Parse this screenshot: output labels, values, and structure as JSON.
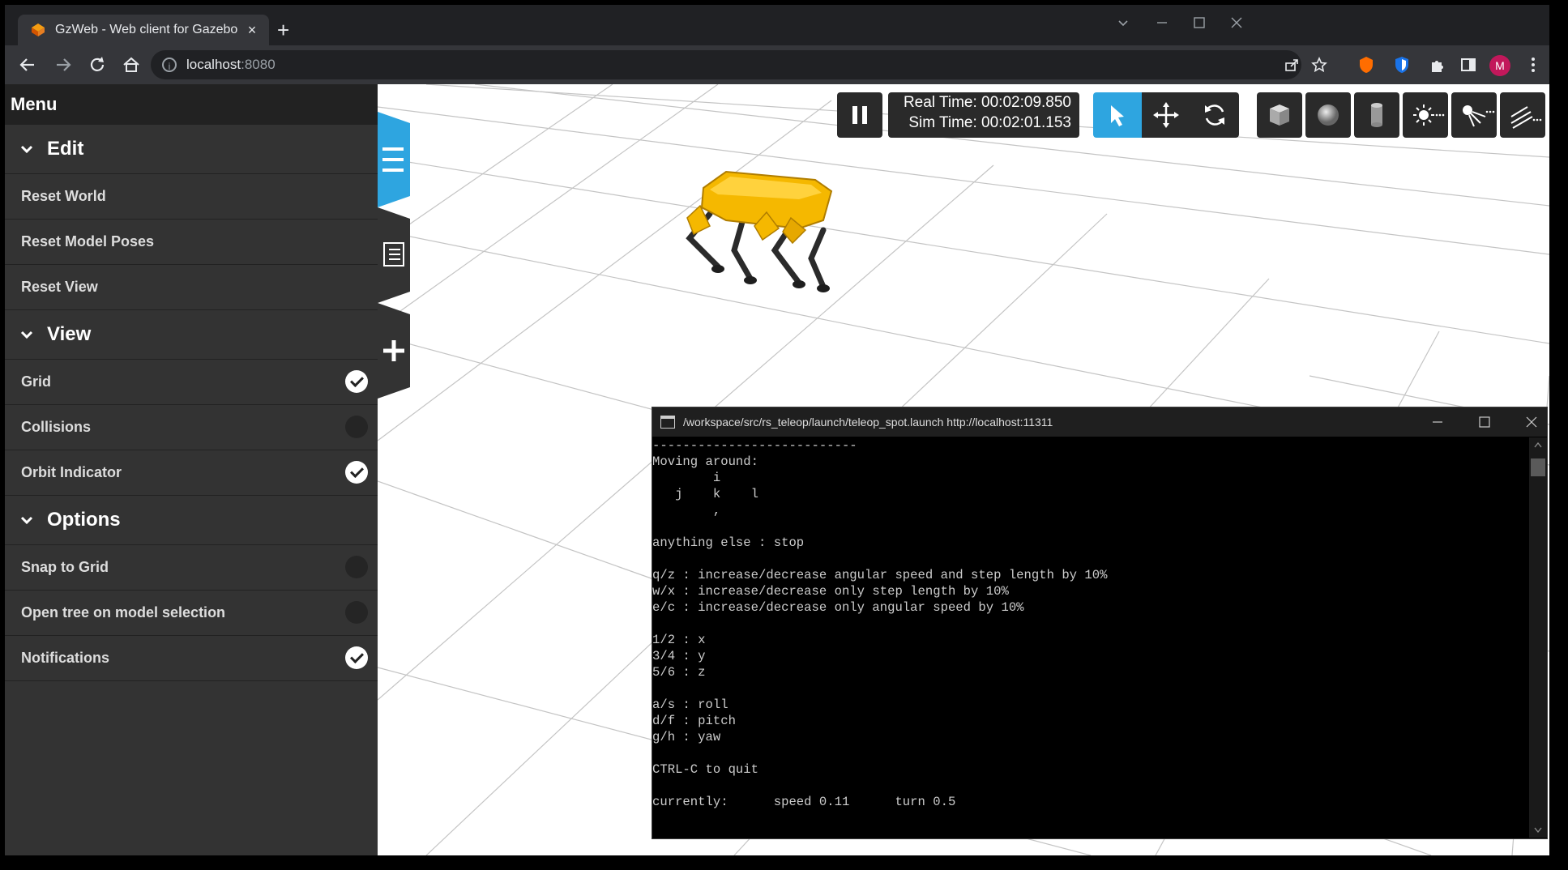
{
  "browser": {
    "tab_title": "GzWeb - Web client for Gazebo",
    "close_glyph": "×",
    "new_tab_glyph": "+",
    "url_host": "localhost",
    "url_port": ":8080",
    "profile_initial": "M",
    "window_controls": [
      "minimize",
      "maximize",
      "close"
    ]
  },
  "menu": {
    "title": "Menu",
    "sections": {
      "edit": "Edit",
      "view": "View",
      "options": "Options"
    },
    "edit_items": [
      "Reset World",
      "Reset Model Poses",
      "Reset View"
    ],
    "view_items": [
      {
        "label": "Grid",
        "checked": true
      },
      {
        "label": "Collisions",
        "checked": false
      },
      {
        "label": "Orbit Indicator",
        "checked": true
      }
    ],
    "option_items": [
      {
        "label": "Snap to Grid",
        "checked": false
      },
      {
        "label": "Open tree on model selection",
        "checked": false
      },
      {
        "label": "Notifications",
        "checked": true
      }
    ]
  },
  "sim": {
    "real_time_label": "Real Time:",
    "real_time": "00:02:09.850",
    "sim_time_label": "Sim Time:",
    "sim_time": "00:02:01.153",
    "tools": [
      "pause-icon",
      "select-arrow-icon",
      "translate-icon",
      "rotate-icon",
      "box-icon",
      "sphere-icon",
      "cylinder-icon",
      "point-light-icon",
      "spot-light-icon",
      "directional-light-icon"
    ],
    "active_tool": "select-arrow-icon",
    "accent_color": "#2ea5e0"
  },
  "terminal": {
    "title": "/workspace/src/rs_teleop/launch/teleop_spot.launch http://localhost:11311",
    "lines": [
      "---------------------------",
      "Moving around:",
      "        i",
      "   j    k    l",
      "        ,",
      "",
      "anything else : stop",
      "",
      "q/z : increase/decrease angular speed and step length by 10%",
      "w/x : increase/decrease only step length by 10%",
      "e/c : increase/decrease only angular speed by 10%",
      "",
      "1/2 : x",
      "3/4 : y",
      "5/6 : z",
      "",
      "a/s : roll",
      "d/f : pitch",
      "g/h : yaw",
      "",
      "CTRL-C to quit",
      "",
      "currently:      speed 0.11      turn 0.5"
    ]
  }
}
